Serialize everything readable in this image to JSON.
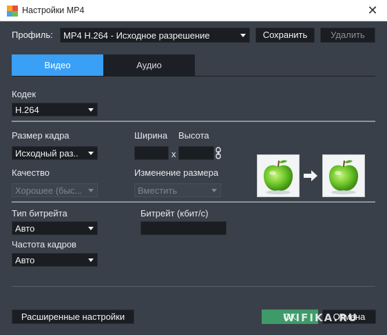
{
  "window": {
    "title": "Настройки MP4",
    "close_glyph": "✕"
  },
  "profile": {
    "label": "Профиль:",
    "value": "MP4 H.264 - Исходное разрешение",
    "save_label": "Сохранить",
    "delete_label": "Удалить"
  },
  "tabs": [
    {
      "label": "Видео",
      "active": true
    },
    {
      "label": "Аудио",
      "active": false
    }
  ],
  "video": {
    "codec_label": "Кодек",
    "codec_value": "H.264",
    "frame_size_label": "Размер кадра",
    "frame_size_value": "Исходный раз..",
    "width_label": "Ширина",
    "height_label": "Высота",
    "x_separator": "x",
    "quality_label": "Качество",
    "quality_value": "Хорошее (быс...",
    "resize_label": "Изменение размера",
    "resize_value": "Вместить",
    "bitrate_type_label": "Тип битрейта",
    "bitrate_type_value": "Авто",
    "bitrate_label": "Битрейт (кбит/с)",
    "framerate_label": "Частота кадров",
    "framerate_value": "Авто"
  },
  "footer": {
    "advanced_label": "Расширенные настройки",
    "ok_label": "OK",
    "cancel_label": "Отмена",
    "watermark": "WIFIKA.RU"
  },
  "colors": {
    "background": "#3a4049",
    "active_tab": "#3aa0f5",
    "field_bg": "#1a1d21",
    "ok_button": "#3f9a6a"
  },
  "icons": [
    "app-icon",
    "close-icon",
    "chevron-down-icon",
    "link-icon",
    "apple-icon",
    "arrow-right-icon"
  ]
}
